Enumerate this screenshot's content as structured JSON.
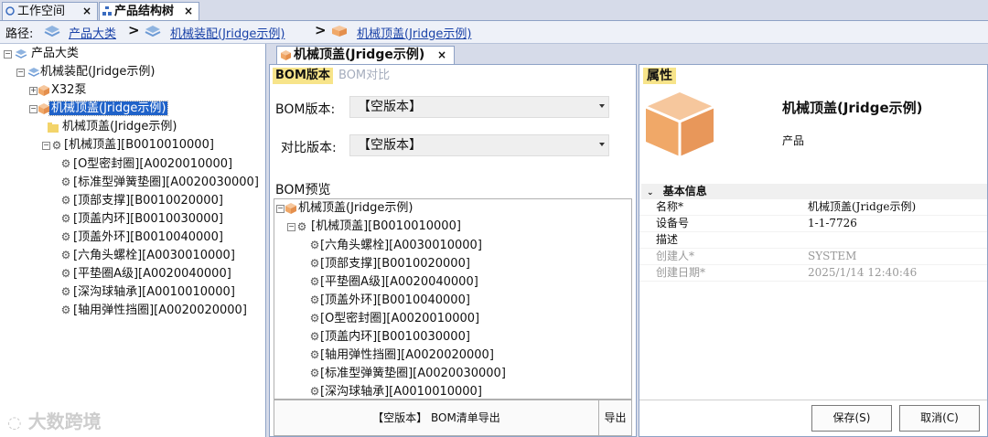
{
  "top_tabs": [
    {
      "label": "工作空间",
      "close": "×",
      "icon": "workspace-icon"
    },
    {
      "label": "产品结构树",
      "close": "×",
      "icon": "tree-icon"
    }
  ],
  "breadcrumb": {
    "prefix": "路径:",
    "items": [
      "产品大类",
      "机械装配(Jridge示例)",
      "机械顶盖(Jridge示例)"
    ],
    "separator": ">"
  },
  "tree": {
    "root": "产品大类",
    "assembly": "机械装配(Jridge示例)",
    "pump": "X32泵",
    "selected": "机械顶盖(Jridge示例)",
    "doc": "机械顶盖(Jridge示例)",
    "bom_root": "[机械顶盖][B0010010000]",
    "parts": [
      "[O型密封圈][A0020010000]",
      "[标准型弹簧垫圈][A0020030000]",
      "[顶部支撑][B0010020000]",
      "[顶盖内环][B0010030000]",
      "[顶盖外环][B0010040000]",
      "[六角头螺栓][A0030010000]",
      "[平垫圈A级][A0020040000]",
      "[深沟球轴承][A0010010000]",
      "[轴用弹性挡圈][A0020020000]"
    ]
  },
  "center": {
    "tab_label": "机械顶盖(Jridge示例)",
    "tab_close": "×",
    "subtabs": [
      "BOM版本",
      "BOM对比"
    ],
    "bom_version_label": "BOM版本:",
    "bom_version_value": "【空版本】",
    "compare_label": "对比版本:",
    "compare_value": "【空版本】",
    "preview_title": "BOM预览",
    "preview_root": "机械顶盖(Jridge示例)",
    "preview_bom": "[机械顶盖][B0010010000]",
    "preview_parts": [
      "[六角头螺栓][A0030010000]",
      "[顶部支撑][B0010020000]",
      "[平垫圈A级][A0020040000]",
      "[顶盖外环][B0010040000]",
      "[O型密封圈][A0020010000]",
      "[顶盖内环][B0010030000]",
      "[轴用弹性挡圈][A0020020000]",
      "[标准型弹簧垫圈][A0020030000]",
      "[深沟球轴承][A0010010000]"
    ],
    "export_main": "【空版本】 BOM清单导出",
    "export_button": "导出"
  },
  "properties": {
    "tab_label": "属性",
    "name": "机械顶盖(Jridge示例)",
    "category": "产品",
    "section_title": "基本信息",
    "rows": [
      {
        "key": "名称*",
        "value": "机械顶盖(Jridge示例)",
        "muted": false
      },
      {
        "key": "设备号",
        "value": "1-1-7726",
        "muted": false
      },
      {
        "key": "描述",
        "value": "",
        "muted": false
      },
      {
        "key": "创建人*",
        "value": "SYSTEM",
        "muted": true
      },
      {
        "key": "创建日期*",
        "value": "2025/1/14 12:40:46",
        "muted": true
      }
    ],
    "save_button": "保存(S)",
    "cancel_button": "取消(C)"
  },
  "watermark": "大数跨境",
  "colors": {
    "accent": "#1f62c9",
    "tab_highlight": "#f7e48a",
    "cube": "#f0a868",
    "link": "#1b43a8"
  }
}
